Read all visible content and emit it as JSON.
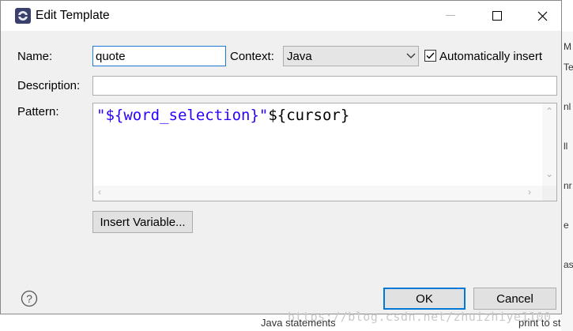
{
  "window": {
    "title": "Edit Template"
  },
  "form": {
    "name_label": "Name:",
    "name_value": "quote",
    "context_label": "Context:",
    "context_value": "Java",
    "auto_insert_label": "Automatically insert",
    "auto_insert_checked": true,
    "description_label": "Description:",
    "description_value": "",
    "pattern_label": "Pattern:",
    "pattern_string": "\"${word_selection}\"",
    "pattern_rest": "${cursor}"
  },
  "buttons": {
    "insert_variable": "Insert Variable...",
    "ok": "OK",
    "cancel": "Cancel"
  },
  "background": {
    "watermark": "https://blog.csdn.net/zhuizhiye1100",
    "bottom_left": "Java statements",
    "bottom_right": "print to st"
  },
  "colors": {
    "string_literal": "#2a00ff",
    "focus_border": "#1e78d6",
    "default_button_border": "#0078d7"
  }
}
